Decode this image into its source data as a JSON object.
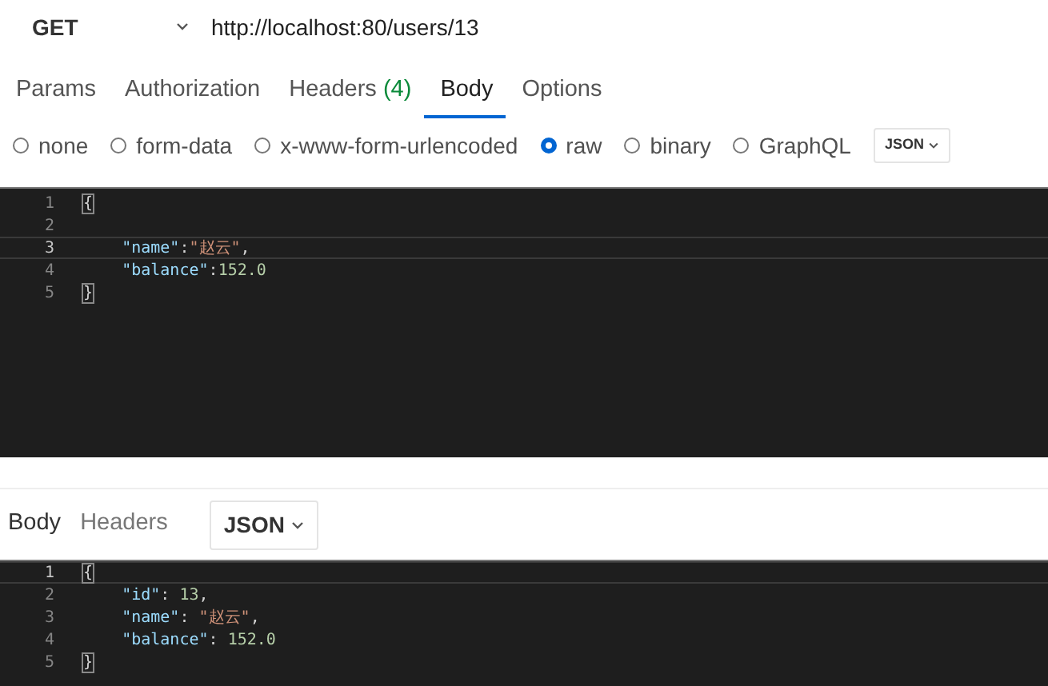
{
  "request": {
    "method": "GET",
    "url": "http://localhost:80/users/13"
  },
  "request_tabs": [
    {
      "label": "Params",
      "selected": false
    },
    {
      "label": "Authorization",
      "selected": false
    },
    {
      "label": "Headers",
      "count": "(4)",
      "selected": false
    },
    {
      "label": "Body",
      "selected": true
    },
    {
      "label": "Options",
      "selected": false
    }
  ],
  "body_types": [
    {
      "label": "none",
      "selected": false
    },
    {
      "label": "form-data",
      "selected": false
    },
    {
      "label": "x-www-form-urlencoded",
      "selected": false
    },
    {
      "label": "raw",
      "selected": true
    },
    {
      "label": "binary",
      "selected": false
    },
    {
      "label": "GraphQL",
      "selected": false
    }
  ],
  "body_format": {
    "label": "JSON"
  },
  "request_editor": {
    "lines": [
      {
        "number": "1",
        "current": false,
        "tokens": [
          {
            "kind": "bracket",
            "text": "{"
          }
        ]
      },
      {
        "number": "2",
        "current": false
      },
      {
        "number": "3",
        "current": true,
        "tokens": [
          {
            "kind": "key",
            "text": "    \"name\""
          },
          {
            "kind": "punct",
            "text": ":"
          },
          {
            "kind": "string",
            "text": "\"赵云\""
          },
          {
            "kind": "punct",
            "text": ","
          }
        ]
      },
      {
        "number": "4",
        "current": false,
        "tokens": [
          {
            "kind": "key",
            "text": "    \"balance\""
          },
          {
            "kind": "punct",
            "text": ":"
          },
          {
            "kind": "number",
            "text": "152.0"
          }
        ]
      },
      {
        "number": "5",
        "current": false,
        "tokens": [
          {
            "kind": "bracket",
            "text": "}"
          }
        ]
      }
    ]
  },
  "response_tabs": [
    {
      "label": "Body",
      "selected": true
    },
    {
      "label": "Headers",
      "selected": false
    }
  ],
  "response_format": {
    "label": "JSON"
  },
  "response_editor": {
    "lines": [
      {
        "number": "1",
        "current": true,
        "tokens": [
          {
            "kind": "bracket",
            "text": "{"
          }
        ]
      },
      {
        "number": "2",
        "current": false,
        "tokens": [
          {
            "kind": "key",
            "text": "    \"id\""
          },
          {
            "kind": "punct",
            "text": ": "
          },
          {
            "kind": "number",
            "text": "13"
          },
          {
            "kind": "punct",
            "text": ","
          }
        ]
      },
      {
        "number": "3",
        "current": false,
        "tokens": [
          {
            "kind": "key",
            "text": "    \"name\""
          },
          {
            "kind": "punct",
            "text": ": "
          },
          {
            "kind": "string",
            "text": "\"赵云\""
          },
          {
            "kind": "punct",
            "text": ","
          }
        ]
      },
      {
        "number": "4",
        "current": false,
        "tokens": [
          {
            "kind": "key",
            "text": "    \"balance\""
          },
          {
            "kind": "punct",
            "text": ": "
          },
          {
            "kind": "number",
            "text": "152.0"
          }
        ]
      },
      {
        "number": "5",
        "current": false,
        "tokens": [
          {
            "kind": "bracket",
            "text": "}"
          }
        ]
      }
    ]
  }
}
